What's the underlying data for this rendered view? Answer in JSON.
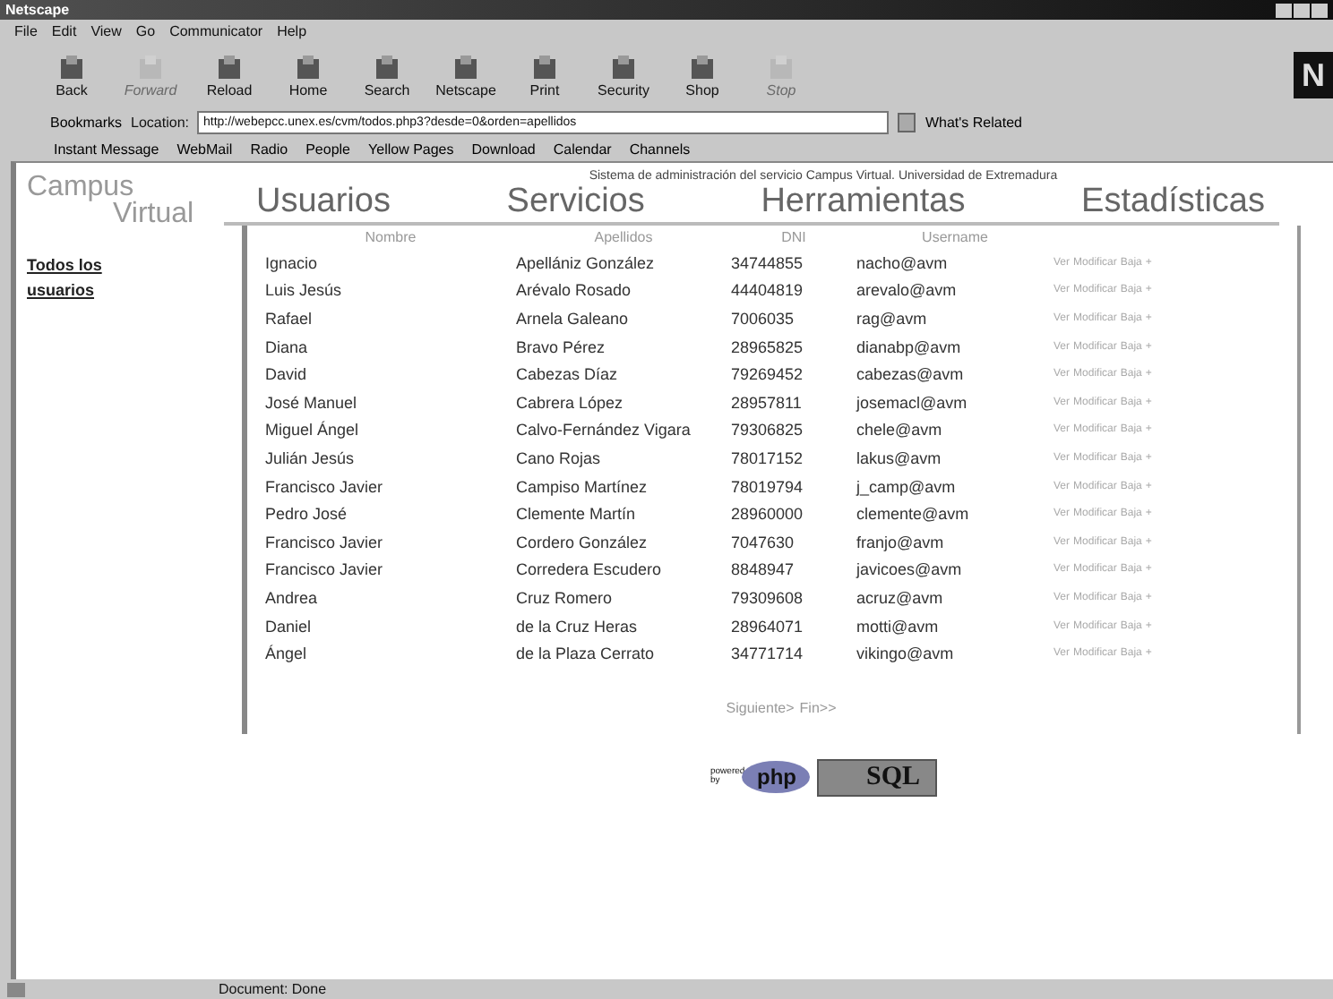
{
  "window": {
    "title": "Netscape"
  },
  "menu": [
    "File",
    "Edit",
    "View",
    "Go",
    "Communicator",
    "Help"
  ],
  "toolbar": [
    {
      "label": "Back",
      "disabled": false
    },
    {
      "label": "Forward",
      "disabled": true
    },
    {
      "label": "Reload",
      "disabled": false
    },
    {
      "label": "Home",
      "disabled": false
    },
    {
      "label": "Search",
      "disabled": false
    },
    {
      "label": "Netscape",
      "disabled": false
    },
    {
      "label": "Print",
      "disabled": false
    },
    {
      "label": "Security",
      "disabled": false
    },
    {
      "label": "Shop",
      "disabled": false
    },
    {
      "label": "Stop",
      "disabled": true
    }
  ],
  "brand_letter": "N",
  "location_bar": {
    "bookmarks": "Bookmarks",
    "location_label": "Location:",
    "url": "http://webepcc.unex.es/cvm/todos.php3?desde=0&orden=apellidos",
    "related": "What's Related"
  },
  "personal_toolbar": [
    "Instant Message",
    "WebMail",
    "Radio",
    "People",
    "Yellow Pages",
    "Download",
    "Calendar",
    "Channels"
  ],
  "page": {
    "logo_top": "Campus",
    "logo_bottom": "Virtual",
    "subtitle": "Sistema de administración del servicio Campus Virtual. Universidad de Extremadura",
    "nav": [
      "Usuarios",
      "Servicios",
      "Herramientas",
      "Estadísticas"
    ],
    "sidebar_link": "Todos los usuarios",
    "columns": [
      "Nombre",
      "Apellidos",
      "DNI",
      "Username"
    ],
    "rows": [
      {
        "nombre": "Ignacio",
        "apellidos": "Apellániz González",
        "dni": "34744855",
        "username": "nacho@avm",
        "actions": [
          "Ver",
          "Modificar",
          "Baja",
          "+"
        ]
      },
      {
        "nombre": "Luis Jesús",
        "apellidos": "Arévalo Rosado",
        "dni": "44404819",
        "username": "arevalo@avm",
        "actions": [
          "Ver",
          "Modificar",
          "Baja",
          "+"
        ]
      },
      {
        "nombre": "Rafael",
        "apellidos": "Arnela Galeano",
        "dni": "7006035",
        "username": "rag@avm",
        "actions": [
          "Ver",
          "Modificar",
          "Baja",
          "+"
        ]
      },
      {
        "nombre": "Diana",
        "apellidos": "Bravo Pérez",
        "dni": "28965825",
        "username": "dianabp@avm",
        "actions": [
          "Ver",
          "Modificar",
          "Baja",
          "+"
        ]
      },
      {
        "nombre": "David",
        "apellidos": "Cabezas Díaz",
        "dni": "79269452",
        "username": "cabezas@avm",
        "actions": [
          "Ver",
          "Modificar",
          "Baja",
          "+"
        ]
      },
      {
        "nombre": "José Manuel",
        "apellidos": "Cabrera López",
        "dni": "28957811",
        "username": "josemacl@avm",
        "actions": [
          "Ver",
          "Modificar",
          "Baja",
          "+"
        ]
      },
      {
        "nombre": "Miguel Ángel",
        "apellidos": "Calvo-Fernández Vigara",
        "dni": "79306825",
        "username": "chele@avm",
        "actions": [
          "Ver",
          "Modificar",
          "Baja",
          "+"
        ]
      },
      {
        "nombre": "Julián Jesús",
        "apellidos": "Cano Rojas",
        "dni": "78017152",
        "username": "lakus@avm",
        "actions": [
          "Ver",
          "Modificar",
          "Baja",
          "+"
        ]
      },
      {
        "nombre": "Francisco Javier",
        "apellidos": "Campiso Martínez",
        "dni": "78019794",
        "username": "j_camp@avm",
        "actions": [
          "Ver",
          "Modificar",
          "Baja",
          "+"
        ]
      },
      {
        "nombre": "Pedro José",
        "apellidos": "Clemente Martín",
        "dni": "28960000",
        "username": "clemente@avm",
        "actions": [
          "Ver",
          "Modificar",
          "Baja",
          "+"
        ]
      },
      {
        "nombre": "Francisco Javier",
        "apellidos": "Cordero González",
        "dni": "7047630",
        "username": "franjo@avm",
        "actions": [
          "Ver",
          "Modificar",
          "Baja",
          "+"
        ]
      },
      {
        "nombre": "Francisco Javier",
        "apellidos": "Corredera Escudero",
        "dni": "8848947",
        "username": "javicoes@avm",
        "actions": [
          "Ver",
          "Modificar",
          "Baja",
          "+"
        ]
      },
      {
        "nombre": "Andrea",
        "apellidos": "Cruz Romero",
        "dni": "79309608",
        "username": "acruz@avm",
        "actions": [
          "Ver",
          "Modificar",
          "Baja",
          "+"
        ]
      },
      {
        "nombre": "Daniel",
        "apellidos": "de la Cruz Heras",
        "dni": "28964071",
        "username": "motti@avm",
        "actions": [
          "Ver",
          "Modificar",
          "Baja",
          "+"
        ]
      },
      {
        "nombre": "Ángel",
        "apellidos": "de la Plaza Cerrato",
        "dni": "34771714",
        "username": "vikingo@avm",
        "actions": [
          "Ver",
          "Modificar",
          "Baja",
          "+"
        ]
      }
    ],
    "pager": [
      "Siguiente>",
      "Fin>>"
    ],
    "badges": [
      {
        "kind": "php",
        "small": "powered by",
        "text": "php"
      },
      {
        "kind": "mysql",
        "text": "SQL"
      }
    ]
  },
  "status_bar": {
    "text": "Document: Done"
  }
}
